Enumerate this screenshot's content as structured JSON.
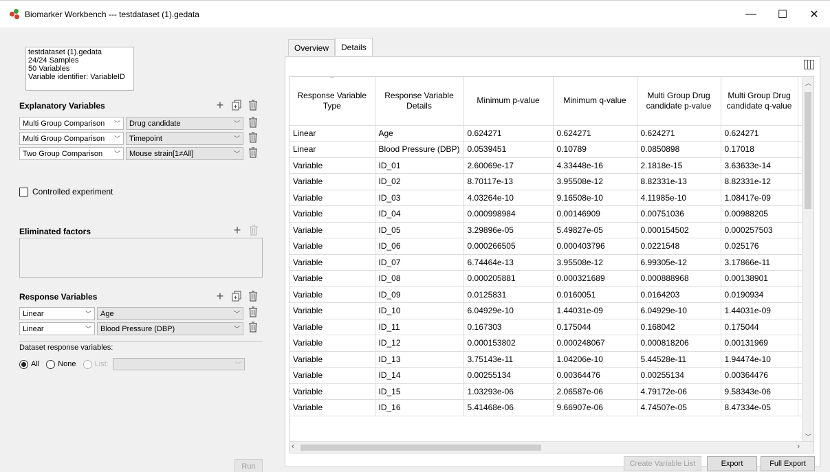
{
  "window": {
    "title": "Biomarker Workbench --- testdataset (1).gedata",
    "logo_colors": [
      "#d83a2e",
      "#3a9a3a",
      "#d83a2e"
    ],
    "minimize": "—",
    "maximize": "☐",
    "close": "✕"
  },
  "dataset_info": {
    "lines": [
      "testdataset (1).gedata",
      "24/24 Samples",
      "50 Variables",
      "Variable identifier: VariableID"
    ]
  },
  "explanatory": {
    "title": "Explanatory Variables",
    "rows": [
      {
        "type": "Multi Group Comparison",
        "variable": "Drug candidate"
      },
      {
        "type": "Multi Group Comparison",
        "variable": "Timepoint"
      },
      {
        "type": "Two Group Comparison",
        "variable": "Mouse strain[1≠All]"
      }
    ]
  },
  "controlled": {
    "label": "Controlled experiment"
  },
  "eliminated": {
    "title": "Eliminated factors"
  },
  "response": {
    "title": "Response Variables",
    "rows": [
      {
        "type": "Linear",
        "variable": "Age"
      },
      {
        "type": "Linear",
        "variable": "Blood Pressure (DBP)"
      }
    ],
    "dataset_label": "Dataset response variables:",
    "radio_all": "All",
    "radio_none": "None",
    "radio_list": "List:"
  },
  "run_label": "Run",
  "tabs": [
    "Overview",
    "Details"
  ],
  "table": {
    "headers": [
      "Response Variable Type",
      "Response Variable Details",
      "Minimum p-value",
      "Minimum q-value",
      "Multi Group Drug candidate p-value",
      "Multi Group Drug candidate q-value"
    ],
    "rows": [
      [
        "Linear",
        "Age",
        "0.624271",
        "0.624271",
        "0.624271",
        "0.624271"
      ],
      [
        "Linear",
        "Blood Pressure (DBP)",
        "0.0539451",
        "0.10789",
        "0.0850898",
        "0.17018"
      ],
      [
        "Variable",
        "ID_01",
        "2.60069e-17",
        "4.33448e-16",
        "2.1818e-15",
        "3.63633e-14"
      ],
      [
        "Variable",
        "ID_02",
        "8.70117e-13",
        "3.95508e-12",
        "8.82331e-13",
        "8.82331e-12"
      ],
      [
        "Variable",
        "ID_03",
        "4.03264e-10",
        "9.16508e-10",
        "4.11985e-10",
        "1.08417e-09"
      ],
      [
        "Variable",
        "ID_04",
        "0.000998984",
        "0.00146909",
        "0.00751036",
        "0.00988205"
      ],
      [
        "Variable",
        "ID_05",
        "3.29896e-05",
        "5.49827e-05",
        "0.000154502",
        "0.000257503"
      ],
      [
        "Variable",
        "ID_06",
        "0.000266505",
        "0.000403796",
        "0.0221548",
        "0.025176"
      ],
      [
        "Variable",
        "ID_07",
        "6.74464e-13",
        "3.95508e-12",
        "6.99305e-12",
        "3.17866e-11"
      ],
      [
        "Variable",
        "ID_08",
        "0.000205881",
        "0.000321689",
        "0.000888968",
        "0.00138901"
      ],
      [
        "Variable",
        "ID_09",
        "0.0125831",
        "0.0160051",
        "0.0164203",
        "0.0190934"
      ],
      [
        "Variable",
        "ID_10",
        "6.04929e-10",
        "1.44031e-09",
        "6.04929e-10",
        "1.44031e-09"
      ],
      [
        "Variable",
        "ID_11",
        "0.167303",
        "0.175044",
        "0.168042",
        "0.175044"
      ],
      [
        "Variable",
        "ID_12",
        "0.000153802",
        "0.000248067",
        "0.000818206",
        "0.00131969"
      ],
      [
        "Variable",
        "ID_13",
        "3.75143e-11",
        "1.04206e-10",
        "5.44528e-11",
        "1.94474e-10"
      ],
      [
        "Variable",
        "ID_14",
        "0.00255134",
        "0.00364476",
        "0.00255134",
        "0.00364476"
      ],
      [
        "Variable",
        "ID_15",
        "1.03293e-06",
        "2.06587e-06",
        "4.79172e-06",
        "9.58343e-06"
      ],
      [
        "Variable",
        "ID_16",
        "5.41468e-06",
        "9.66907e-06",
        "4.74507e-05",
        "8.47334e-05"
      ]
    ]
  },
  "buttons": {
    "create_list": "Create Variable List",
    "export": "Export",
    "full_export": "Full Export"
  }
}
